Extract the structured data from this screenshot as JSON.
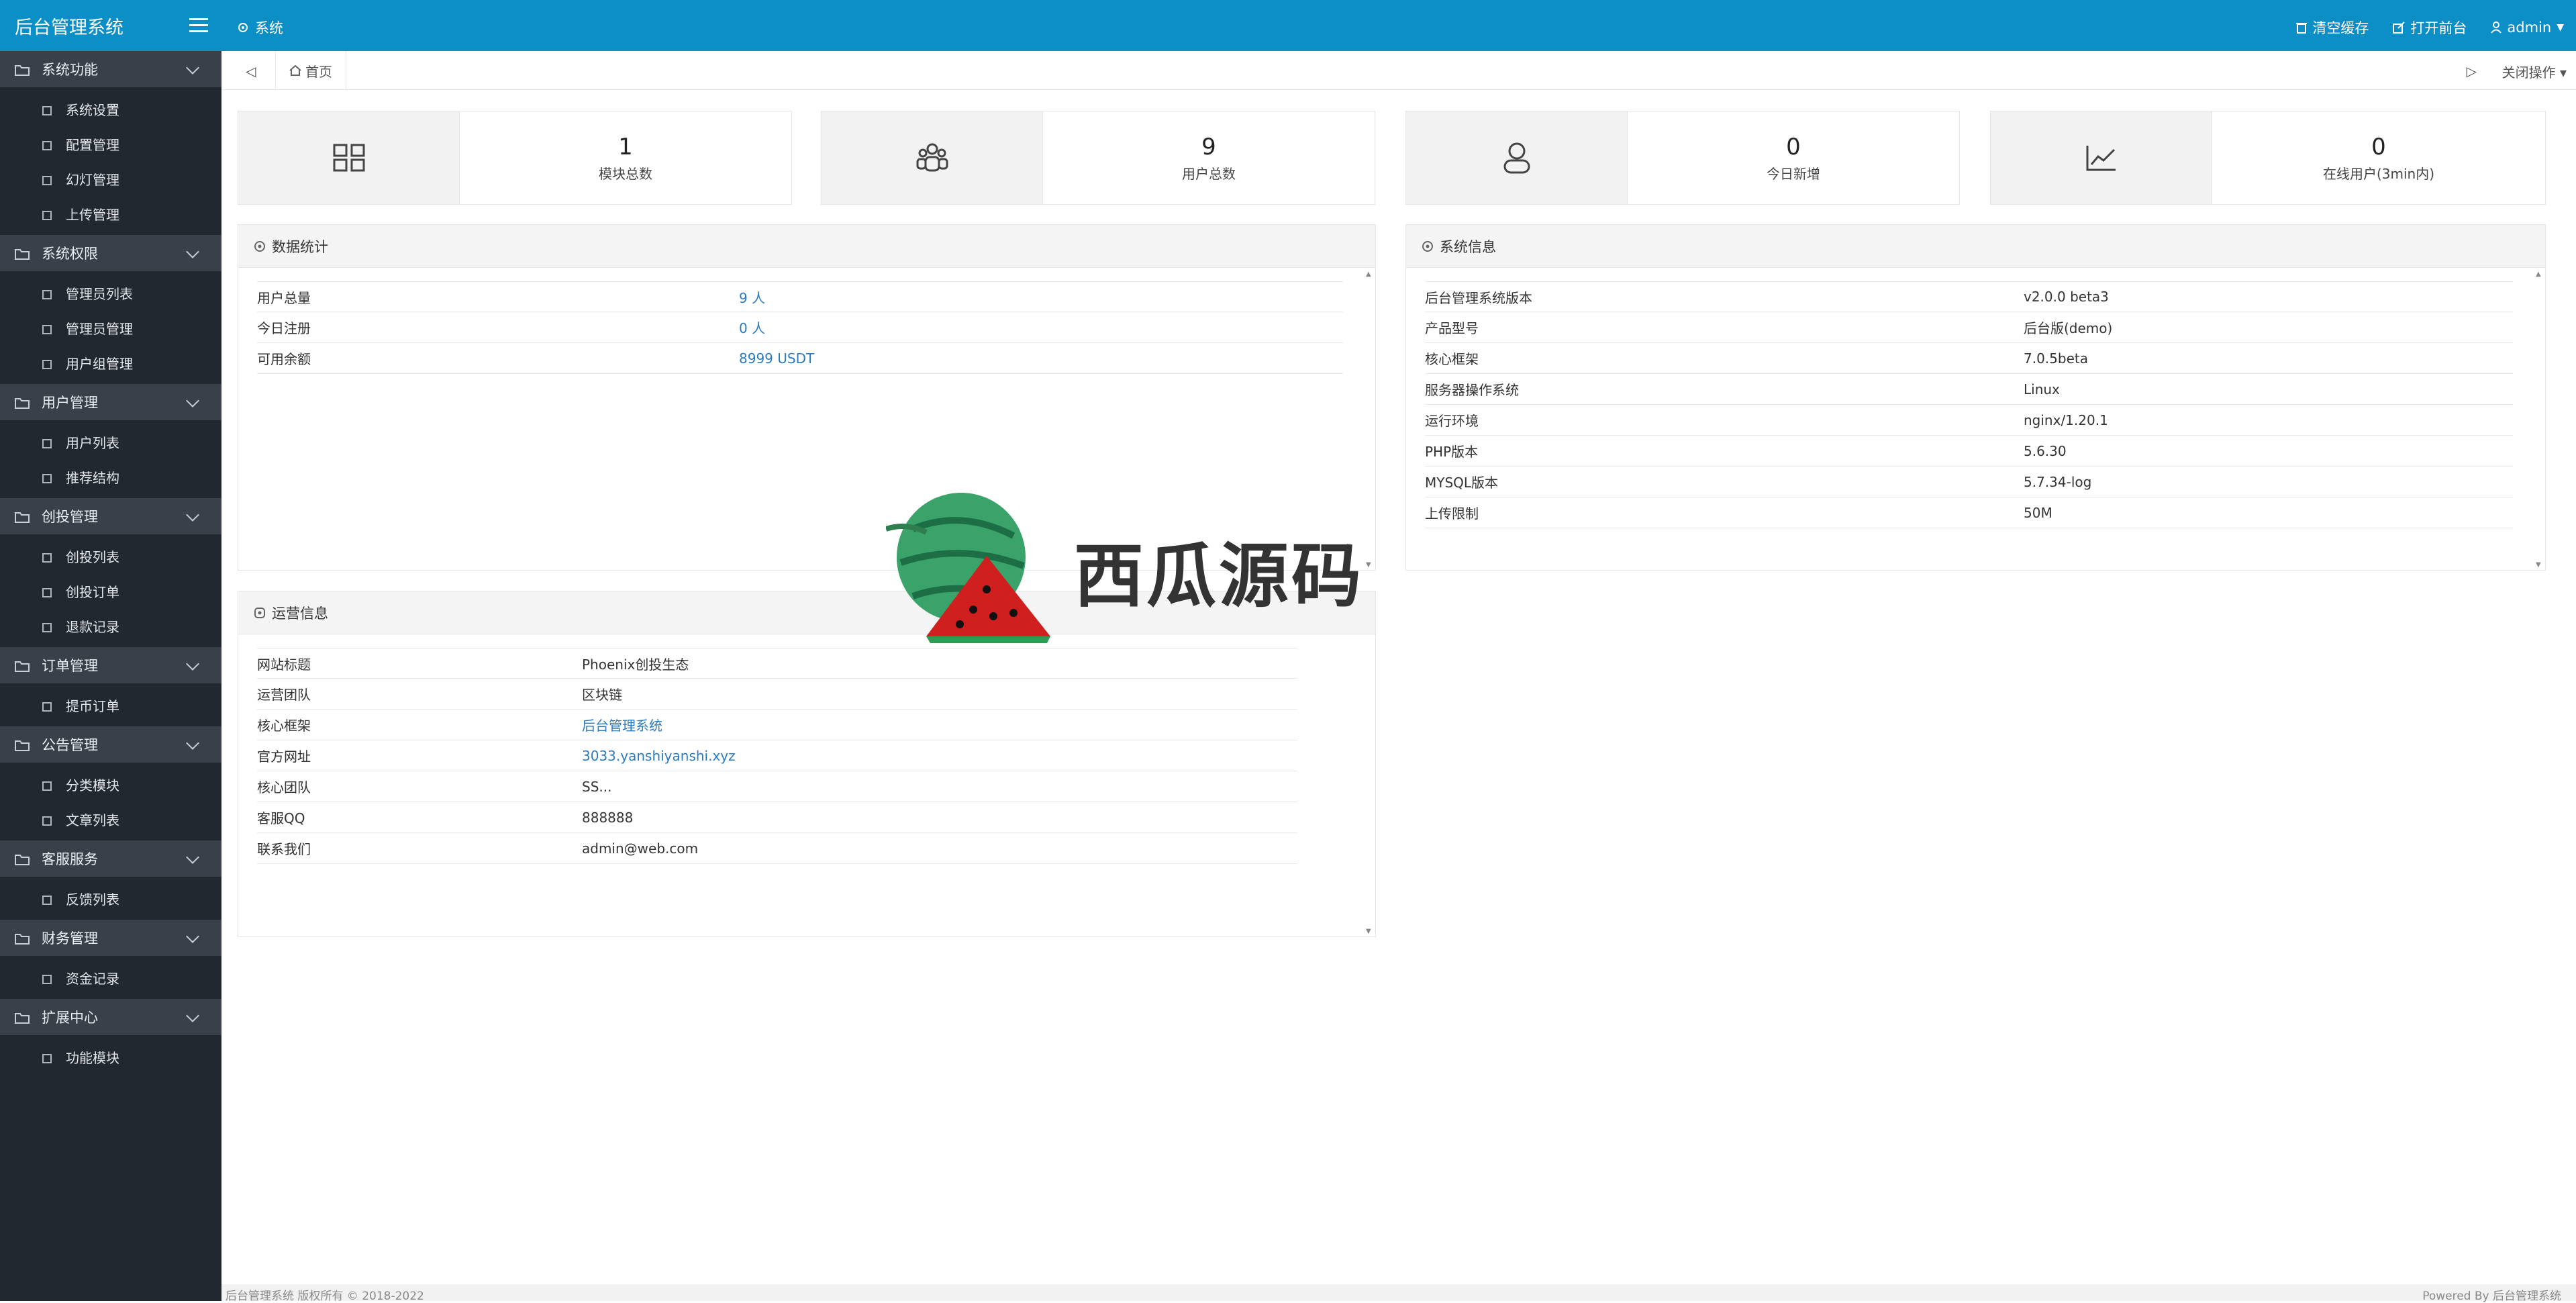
{
  "app": {
    "title": "后台管理系统"
  },
  "sidebar": {
    "groups": [
      {
        "label": "系统功能",
        "items": [
          "系统设置",
          "配置管理",
          "幻灯管理",
          "上传管理"
        ]
      },
      {
        "label": "系统权限",
        "items": [
          "管理员列表",
          "管理员管理",
          "用户组管理"
        ]
      },
      {
        "label": "用户管理",
        "items": [
          "用户列表",
          "推荐结构"
        ]
      },
      {
        "label": "创投管理",
        "items": [
          "创投列表",
          "创投订单",
          "退款记录"
        ]
      },
      {
        "label": "订单管理",
        "items": [
          "提币订单"
        ]
      },
      {
        "label": "公告管理",
        "items": [
          "分类模块",
          "文章列表"
        ]
      },
      {
        "label": "客服服务",
        "items": [
          "反馈列表"
        ]
      },
      {
        "label": "财务管理",
        "items": [
          "资金记录"
        ]
      },
      {
        "label": "扩展中心",
        "items": [
          "功能模块"
        ]
      }
    ]
  },
  "topbar": {
    "breadcrumb": "系统",
    "clear_cache": "清空缓存",
    "open_front": "打开前台",
    "user": "admin"
  },
  "tabs": {
    "home": "首页",
    "close_ops": "关闭操作"
  },
  "stats": [
    {
      "value": "1",
      "label": "模块总数",
      "icon": "grid-icon"
    },
    {
      "value": "9",
      "label": "用户总数",
      "icon": "users-icon"
    },
    {
      "value": "0",
      "label": "今日新增",
      "icon": "user-icon"
    },
    {
      "value": "0",
      "label": "在线用户(3min内)",
      "icon": "chart-icon"
    }
  ],
  "data_stats": {
    "title": "数据统计",
    "rows": [
      {
        "k": "用户总量",
        "v": "9 人"
      },
      {
        "k": "今日注册",
        "v": "0 人"
      },
      {
        "k": "可用余额",
        "v": "8999 USDT"
      }
    ]
  },
  "sys_info": {
    "title": "系统信息",
    "rows": [
      {
        "k": "后台管理系统版本",
        "v": "v2.0.0 beta3"
      },
      {
        "k": "产品型号",
        "v": "后台版(demo)"
      },
      {
        "k": "核心框架",
        "v": "7.0.5beta"
      },
      {
        "k": "服务器操作系统",
        "v": "Linux"
      },
      {
        "k": "运行环境",
        "v": "nginx/1.20.1"
      },
      {
        "k": "PHP版本",
        "v": "5.6.30"
      },
      {
        "k": "MYSQL版本",
        "v": "5.7.34-log"
      },
      {
        "k": "上传限制",
        "v": "50M"
      }
    ]
  },
  "ops_info": {
    "title": "运营信息",
    "rows": [
      {
        "k": "网站标题",
        "v": "Phoenix创投生态"
      },
      {
        "k": "运营团队",
        "v": "区块链"
      },
      {
        "k": "核心框架",
        "v": "后台管理系统"
      },
      {
        "k": "官方网址",
        "v": "3033.yanshiyanshi.xyz"
      },
      {
        "k": "核心团队",
        "v": "SS..."
      },
      {
        "k": "客服QQ",
        "v": "888888"
      },
      {
        "k": "联系我们",
        "v": "admin@web.com"
      }
    ]
  },
  "watermark": "西瓜源码",
  "footer": {
    "left": "后台管理系统 版权所有 © 2018-2022",
    "right": "Powered By 后台管理系统"
  },
  "colors": {
    "accent": "#0b8fc6",
    "sidebar": "#22282f",
    "sidebar_group": "#39404a",
    "link": "#2a7bbf"
  }
}
